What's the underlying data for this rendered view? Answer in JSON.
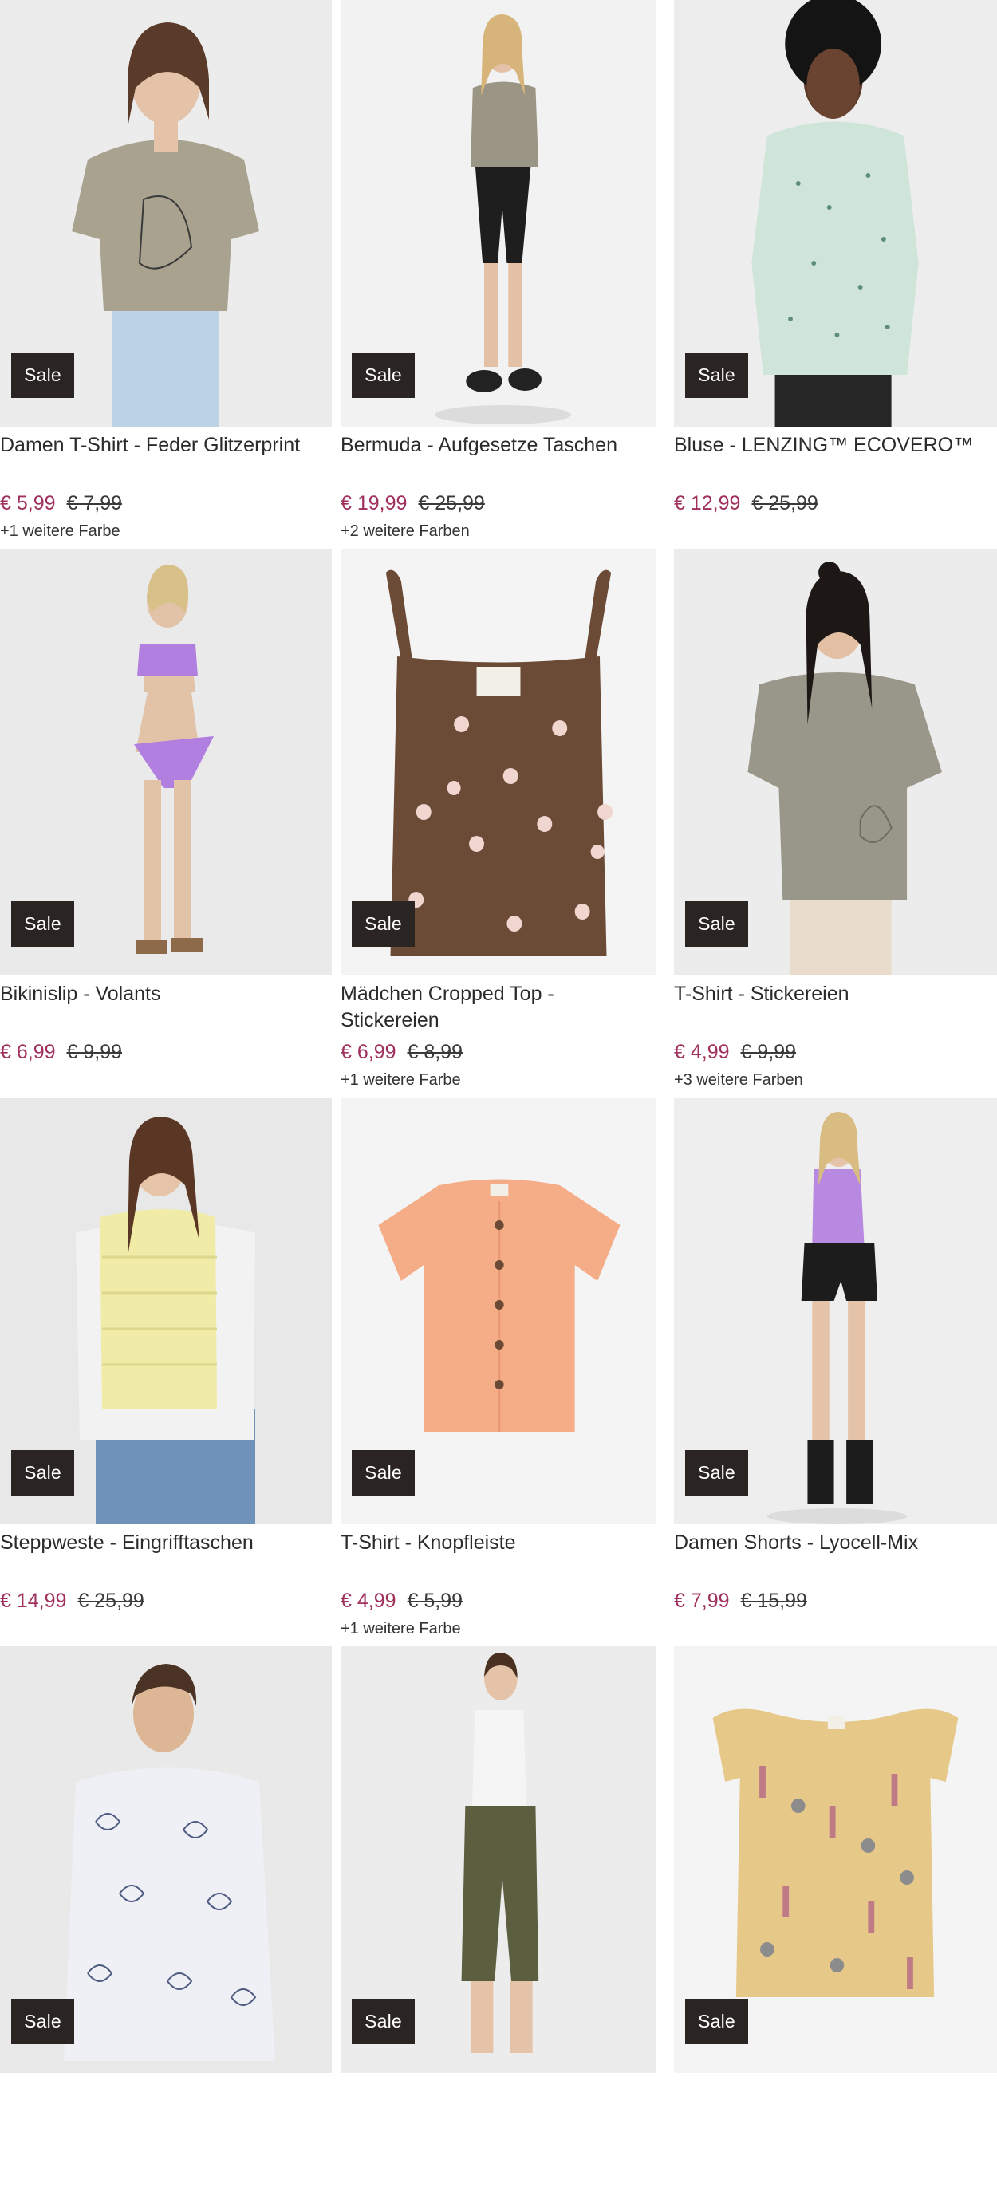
{
  "sale_label": "Sale",
  "colors": {
    "price_now": "#a0305c",
    "sale_badge_bg": "#2a2522",
    "sale_badge_text": "#ffffff"
  },
  "products": [
    {
      "name": "Damen T-Shirt - Feder Glitzerprint",
      "price_now": "€ 5,99",
      "price_old": "€ 7,99",
      "more_colors": "+1 weitere Farbe",
      "sale": "Sale",
      "image": "woman-khaki-tshirt-photo"
    },
    {
      "name": "Bermuda - Aufgesetze Taschen",
      "price_now": "€ 19,99",
      "price_old": "€ 25,99",
      "more_colors": "+2 weitere Farben",
      "sale": "Sale",
      "image": "woman-black-bermuda-photo"
    },
    {
      "name": "Bluse - LENZING™ ECOVERO™",
      "price_now": "€ 12,99",
      "price_old": "€ 25,99",
      "more_colors": "",
      "sale": "Sale",
      "image": "woman-mint-blouse-photo"
    },
    {
      "name": "Bikinislip - Volants",
      "price_now": "€ 6,99",
      "price_old": "€ 9,99",
      "more_colors": "",
      "sale": "Sale",
      "image": "woman-purple-bikini-photo"
    },
    {
      "name": "Mädchen Cropped Top - Stickereien",
      "price_now": "€ 6,99",
      "price_old": "€ 8,99",
      "more_colors": "+1 weitere Farbe",
      "sale": "Sale",
      "image": "brown-flower-top-photo"
    },
    {
      "name": "T-Shirt - Stickereien",
      "price_now": "€ 4,99",
      "price_old": "€ 9,99",
      "more_colors": "+3 weitere Farben",
      "sale": "Sale",
      "image": "woman-olive-tshirt-photo"
    },
    {
      "name": "Steppweste - Eingrifftaschen",
      "price_now": "€ 14,99",
      "price_old": "€ 25,99",
      "more_colors": "",
      "sale": "Sale",
      "image": "woman-yellow-vest-photo"
    },
    {
      "name": "T-Shirt - Knopfleiste",
      "price_now": "€ 4,99",
      "price_old": "€ 5,99",
      "more_colors": "+1 weitere Farbe",
      "sale": "Sale",
      "image": "peach-button-tshirt-photo"
    },
    {
      "name": "Damen Shorts - Lyocell-Mix",
      "price_now": "€ 7,99",
      "price_old": "€ 15,99",
      "more_colors": "",
      "sale": "Sale",
      "image": "woman-black-shorts-photo"
    },
    {
      "name": "",
      "price_now": "",
      "price_old": "",
      "more_colors": "",
      "sale": "Sale",
      "image": "man-floral-shirt-photo"
    },
    {
      "name": "",
      "price_now": "",
      "price_old": "",
      "more_colors": "",
      "sale": "Sale",
      "image": "woman-olive-pants-photo"
    },
    {
      "name": "",
      "price_now": "",
      "price_old": "",
      "more_colors": "",
      "sale": "Sale",
      "image": "beige-animal-print-top-photo"
    }
  ]
}
